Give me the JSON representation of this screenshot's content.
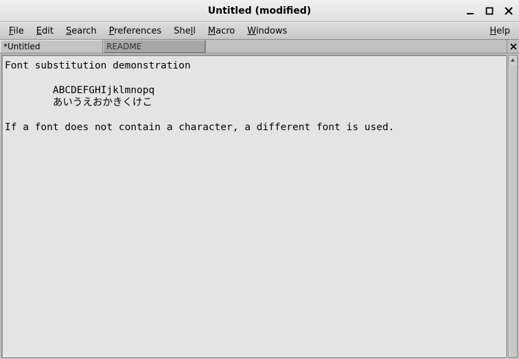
{
  "window": {
    "title": "Untitled (modified)"
  },
  "menu": {
    "file": "File",
    "edit": "Edit",
    "search": "Search",
    "preferences": "Preferences",
    "shell": "Shell",
    "macro": "Macro",
    "windows": "Windows",
    "help": "Help"
  },
  "tabs": [
    {
      "label": "*Untitled",
      "active": true
    },
    {
      "label": "README",
      "active": false
    }
  ],
  "editor": {
    "content": "Font substitution demonstration\n\n        ABCDEFGHIjklmnopq\n        あいうえおかきくけこ\n\nIf a font does not contain a character, a different font is used."
  }
}
